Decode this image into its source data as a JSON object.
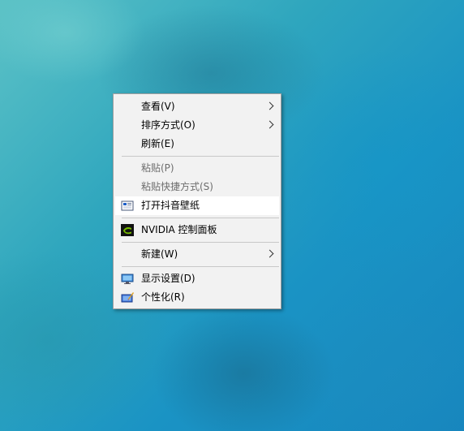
{
  "context_menu": {
    "items": [
      {
        "label": "查看(V)"
      },
      {
        "label": "排序方式(O)"
      },
      {
        "label": "刷新(E)"
      },
      {
        "label": "粘贴(P)"
      },
      {
        "label": "粘贴快捷方式(S)"
      },
      {
        "label": "打开抖音壁纸",
        "icon": "wallpaper-app-icon"
      },
      {
        "label": "NVIDIA 控制面板",
        "icon": "nvidia-icon"
      },
      {
        "label": "新建(W)"
      },
      {
        "label": "显示设置(D)",
        "icon": "display-icon"
      },
      {
        "label": "个性化(R)",
        "icon": "personalize-icon"
      }
    ]
  }
}
